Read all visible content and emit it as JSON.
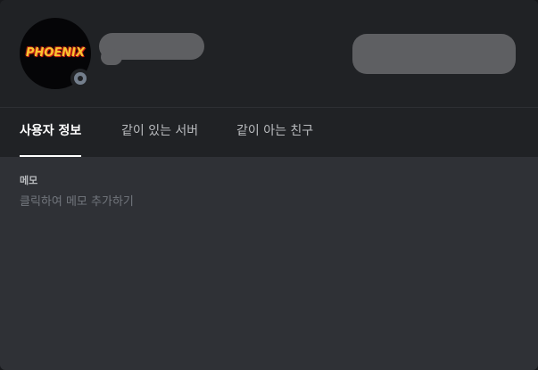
{
  "profile": {
    "avatar_text": "PHOENIX",
    "status": "offline",
    "colors": {
      "header_bg": "#202225",
      "body_bg": "#2f3136",
      "status_gray": "#747f8d",
      "redaction": "#5e5f62"
    }
  },
  "tabs": [
    {
      "label": "사용자 정보",
      "active": true
    },
    {
      "label": "같이 있는 서버",
      "active": false
    },
    {
      "label": "같이 아는 친구",
      "active": false
    }
  ],
  "memo": {
    "label": "메모",
    "placeholder": "클릭하여 메모 추가하기",
    "value": ""
  }
}
